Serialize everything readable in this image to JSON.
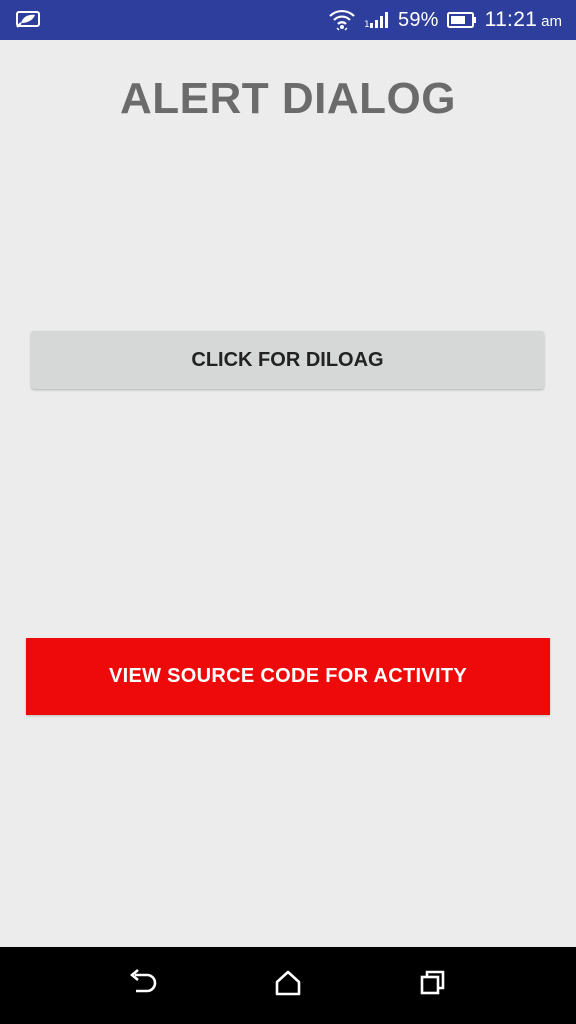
{
  "status_bar": {
    "battery_percent": "59%",
    "time": "11:21",
    "ampm": "am",
    "icons": [
      "notification-leaf-icon",
      "wifi-icon",
      "signal-icon",
      "battery-icon"
    ],
    "background_color": "#2d3e9c"
  },
  "main": {
    "title": "ALERT DIALOG",
    "dialog_button_label": "CLICK FOR DILOAG",
    "source_button_label": "VIEW SOURCE CODE FOR ACTIVITY",
    "source_button_color": "#ee0a0a"
  },
  "nav_bar": {
    "icons": [
      "back-icon",
      "home-icon",
      "recents-icon"
    ]
  }
}
